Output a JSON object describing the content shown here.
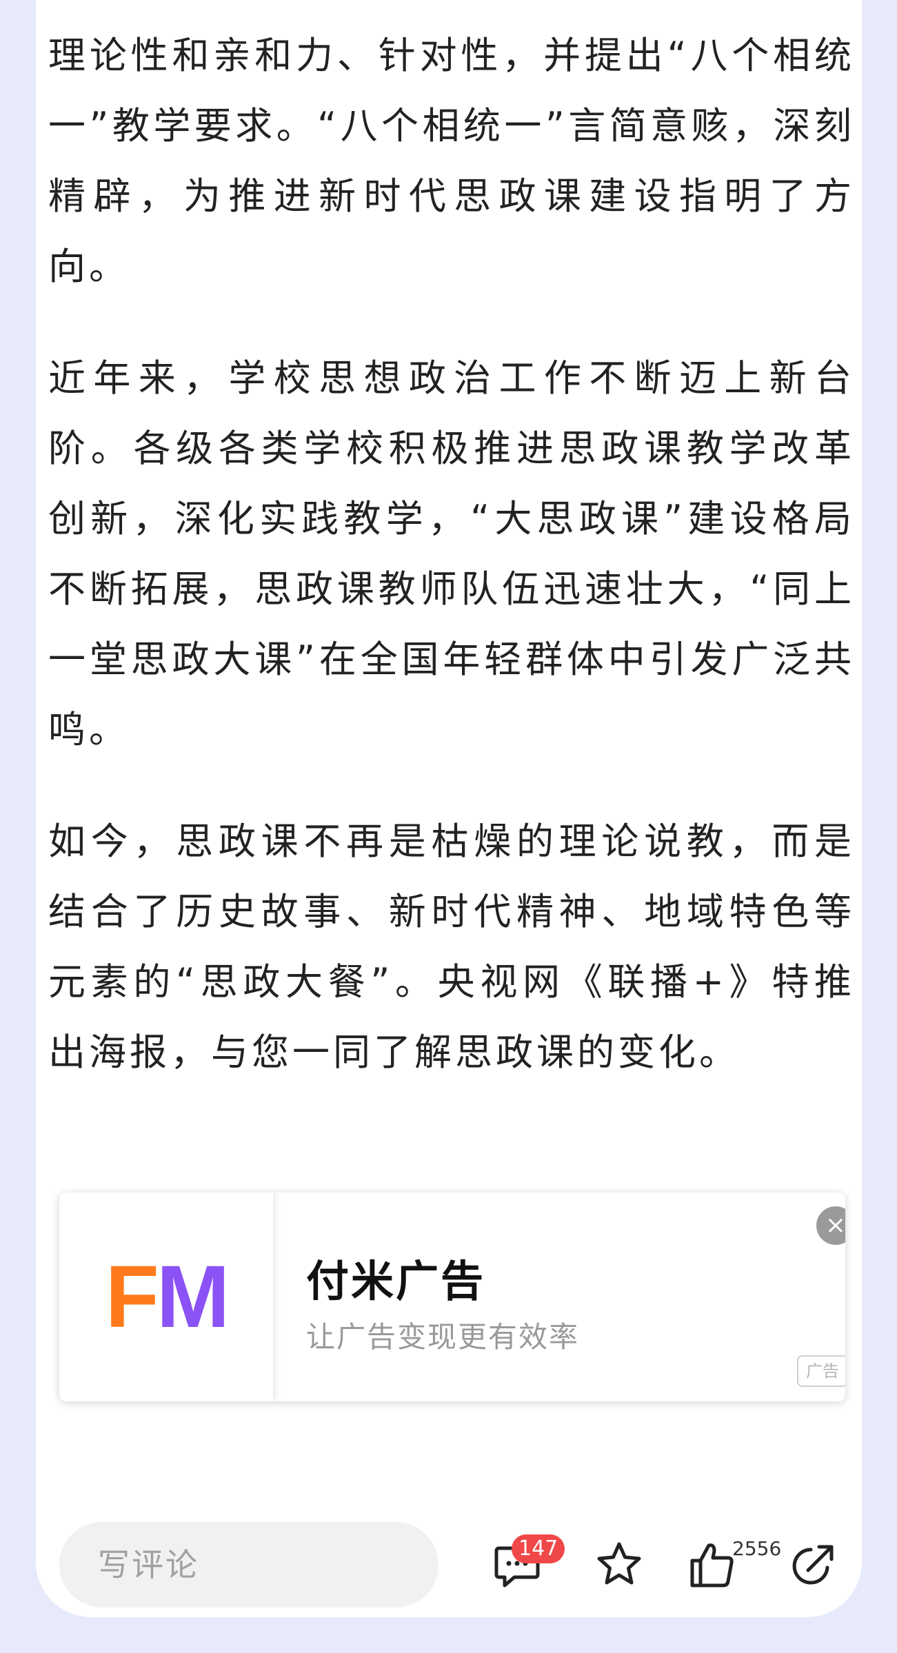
{
  "article": {
    "paragraphs": [
      "理论性和亲和力、针对性，并提出“八个相统一”教学要求。“八个相统一”言简意赅，深刻精辟，为推进新时代思政课建设指明了方向。",
      "近年来，学校思想政治工作不断迈上新台阶。各级各类学校积极推进思政课教学改革创新，深化实践教学，“大思政课”建设格局不断拓展，思政课教师队伍迅速壮大，“同上一堂思政大课”在全国年轻群体中引发广泛共鸣。",
      "如今，思政课不再是枯燥的理论说教，而是结合了历史故事、新时代精神、地域特色等元素的“思政大餐”。央视网《联播+》特推出海报，与您一同了解思政课的变化。"
    ]
  },
  "ad": {
    "logo_f": "F",
    "logo_m": "M",
    "title": "付米广告",
    "subtitle": "让广告变现更有效率",
    "tag": "广告",
    "close_glyph": "×"
  },
  "bottom_bar": {
    "comment_placeholder": "写评论",
    "comment_count": "147",
    "like_count": "2556",
    "icons": [
      "comment-icon",
      "star-icon",
      "thumbs-up-icon",
      "share-icon"
    ]
  }
}
